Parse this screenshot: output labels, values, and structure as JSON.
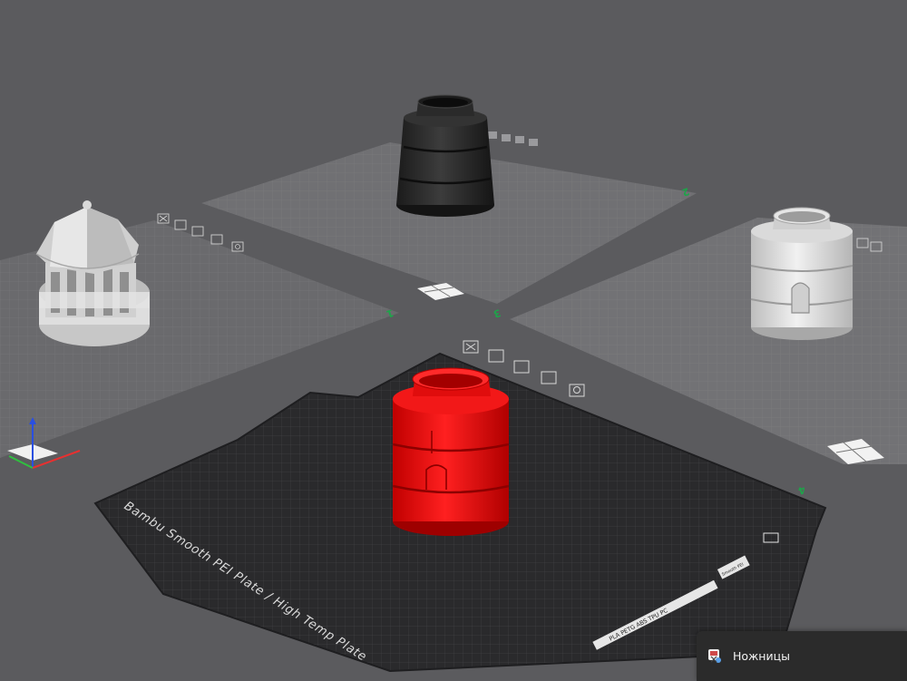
{
  "scene": {
    "background": "#5b5b5e",
    "plates": [
      {
        "id": "plate-1",
        "label_text": "1",
        "object": "domed pavilion tower",
        "object_color": "#d9d9d9"
      },
      {
        "id": "plate-2",
        "label_text": "2",
        "object": "cylindrical jar",
        "object_color": "#2a2a2a"
      },
      {
        "id": "plate-3",
        "label_text": "3",
        "object": "cylindrical jar with door",
        "object_color": "#d4d4d4"
      },
      {
        "id": "plate-4",
        "label_text": "4",
        "object": "cylindrical jar",
        "object_color": "#e31010",
        "selected": true
      }
    ],
    "plate_toolbar_icons": [
      "close-icon",
      "orient-icon",
      "arrange-icon",
      "lock-icon",
      "settings-icon"
    ],
    "bed": {
      "label": "Bambu Smooth PEI Plate / High Temp Plate",
      "compatibility": "PLA PETG ABS TPU PC",
      "badge": "Smooth PEI"
    },
    "axes": {
      "x_color": "#e83030",
      "y_color": "#2fbf3f",
      "z_color": "#2a4fe0"
    }
  },
  "toast": {
    "app_name": "Ножницы",
    "icon": "scissors-app-icon"
  }
}
